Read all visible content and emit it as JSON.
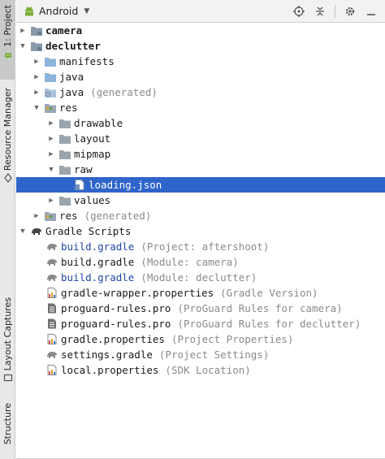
{
  "side_tabs": {
    "project": "1: Project",
    "resource_manager": "Resource Manager",
    "layout_captures": "Layout Captures",
    "structure": "Structure"
  },
  "toolbar": {
    "view_selector": "Android",
    "icons": [
      "locate-icon",
      "collapse-all-icon",
      "gear-icon",
      "hide-icon"
    ]
  },
  "colors": {
    "selection": "#2f65ca",
    "folder": "#8cb4d8",
    "gradle_name": "#1f47a8",
    "hint": "#8a8a8a"
  },
  "tree": [
    {
      "label": "camera",
      "hint": ""
    },
    {
      "label": "declutter",
      "hint": ""
    },
    {
      "label": "manifests",
      "hint": ""
    },
    {
      "label": "java",
      "hint": ""
    },
    {
      "label": "java",
      "hint": "(generated)"
    },
    {
      "label": "res",
      "hint": ""
    },
    {
      "label": "drawable",
      "hint": ""
    },
    {
      "label": "layout",
      "hint": ""
    },
    {
      "label": "mipmap",
      "hint": ""
    },
    {
      "label": "raw",
      "hint": ""
    },
    {
      "label": "loading.json",
      "hint": ""
    },
    {
      "label": "values",
      "hint": ""
    },
    {
      "label": "res",
      "hint": "(generated)"
    },
    {
      "label": "Gradle Scripts",
      "hint": ""
    },
    {
      "label": "build.gradle",
      "hint": "(Project: aftershoot)"
    },
    {
      "label": "build.gradle",
      "hint": "(Module: camera)"
    },
    {
      "label": "build.gradle",
      "hint": "(Module: declutter)"
    },
    {
      "label": "gradle-wrapper.properties",
      "hint": "(Gradle Version)"
    },
    {
      "label": "proguard-rules.pro",
      "hint": "(ProGuard Rules for camera)"
    },
    {
      "label": "proguard-rules.pro",
      "hint": "(ProGuard Rules for declutter)"
    },
    {
      "label": "gradle.properties",
      "hint": "(Project Properties)"
    },
    {
      "label": "settings.gradle",
      "hint": "(Project Settings)"
    },
    {
      "label": "local.properties",
      "hint": "(SDK Location)"
    }
  ]
}
